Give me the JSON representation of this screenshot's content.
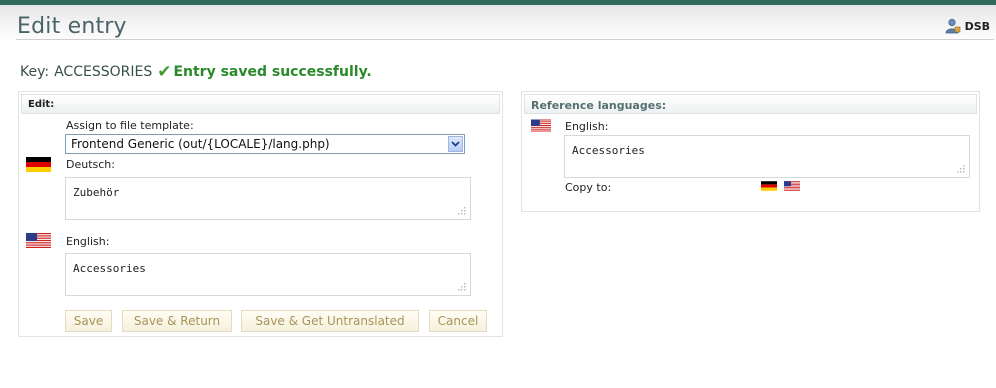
{
  "header": {
    "title": "Edit entry",
    "user": "DSB"
  },
  "status": {
    "key_label": "Key:",
    "key_value": "ACCESSORIES",
    "message": "Entry saved successfully."
  },
  "edit": {
    "title": "Edit:",
    "template_label": "Assign to file template:",
    "template_value": "Frontend Generic (out/{LOCALE}/lang.php)",
    "languages": [
      {
        "label": "Deutsch:",
        "value": "Zubehör",
        "flag": "german-flag-icon"
      },
      {
        "label": "English:",
        "value": "Accessories",
        "flag": "us-flag-icon"
      }
    ],
    "buttons": [
      "Save",
      "Save & Return",
      "Save & Get Untranslated",
      "Cancel"
    ]
  },
  "reference": {
    "title": "Reference languages:",
    "label": "English:",
    "value": "Accessories",
    "copy_to": "Copy to:"
  },
  "colors": {
    "accent": "#2f6b5b",
    "success": "#2a8a2a",
    "title": "#4a6468"
  }
}
